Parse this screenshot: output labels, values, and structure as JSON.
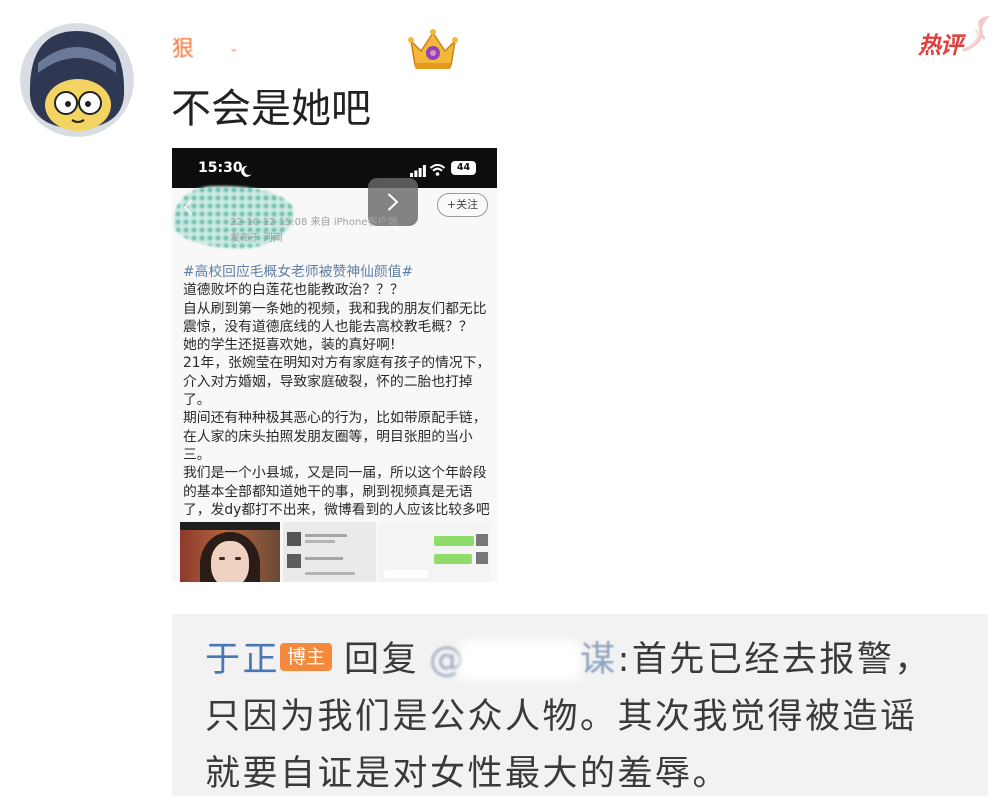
{
  "comment": {
    "username": "狠",
    "username_tail": "-",
    "hot_label": "热评",
    "text": "不会是她吧"
  },
  "embedded_image": {
    "status_bar": {
      "time": "15:30",
      "battery": "44"
    },
    "post_header": {
      "follow_label": "+关注",
      "meta": "22-10-12 15:08 来自 iPhone客户端",
      "location": "发布于 河南"
    },
    "post_lines": [
      "#高校回应毛概女老师被赞神仙颜值#",
      "道德败坏的白莲花也能教政治？？？",
      "自从刷到第一条她的视频，我和我的朋友们都无比",
      "震惊，没有道德底线的人也能去高校教毛概？？",
      "她的学生还挺喜欢她，装的真好啊!",
      "21年，张婉莹在明知对方有家庭有孩子的情况下，",
      "介入对方婚姻，导致家庭破裂，怀的二胎也打掉",
      "了。",
      "期间还有种种极其恶心的行为，比如带原配手链，",
      "在人家的床头拍照发朋友圈等，明目张胆的当小",
      "三。",
      "我们是一个小县城，又是同一届，所以这个年龄段",
      "的基本全部都知道她干的事，刷到视频真是无语",
      "了，发dy都打不出来，微博看到的人应该比较多吧"
    ]
  },
  "reply": {
    "author": "于正",
    "author_badge": "博主",
    "reply_label": "回复",
    "mention_prefix": "@",
    "mention_tail": "谋",
    "lines": [
      ":首先已经去报警，",
      "只因为我们是公众人物。其次我觉得被造谣",
      "就要自证是对女性最大的羞辱。"
    ]
  },
  "icons": {
    "avatar": "cartoon-helmet-avatar",
    "fan_badge": "crown-badge-icon",
    "hot": "flame-icon",
    "moon": "moon-icon",
    "signal": "signal-icon",
    "wifi": "wifi-icon",
    "back": "back-arrow-icon",
    "next": "chevron-right-icon"
  },
  "colors": {
    "username": "#f07a3c",
    "hot_label": "#e23d3a",
    "author_link": "#4877b5",
    "blogger_badge": "#f5893b",
    "reply_background": "#f2f2f2",
    "hashtag": "#5f7fa6"
  }
}
